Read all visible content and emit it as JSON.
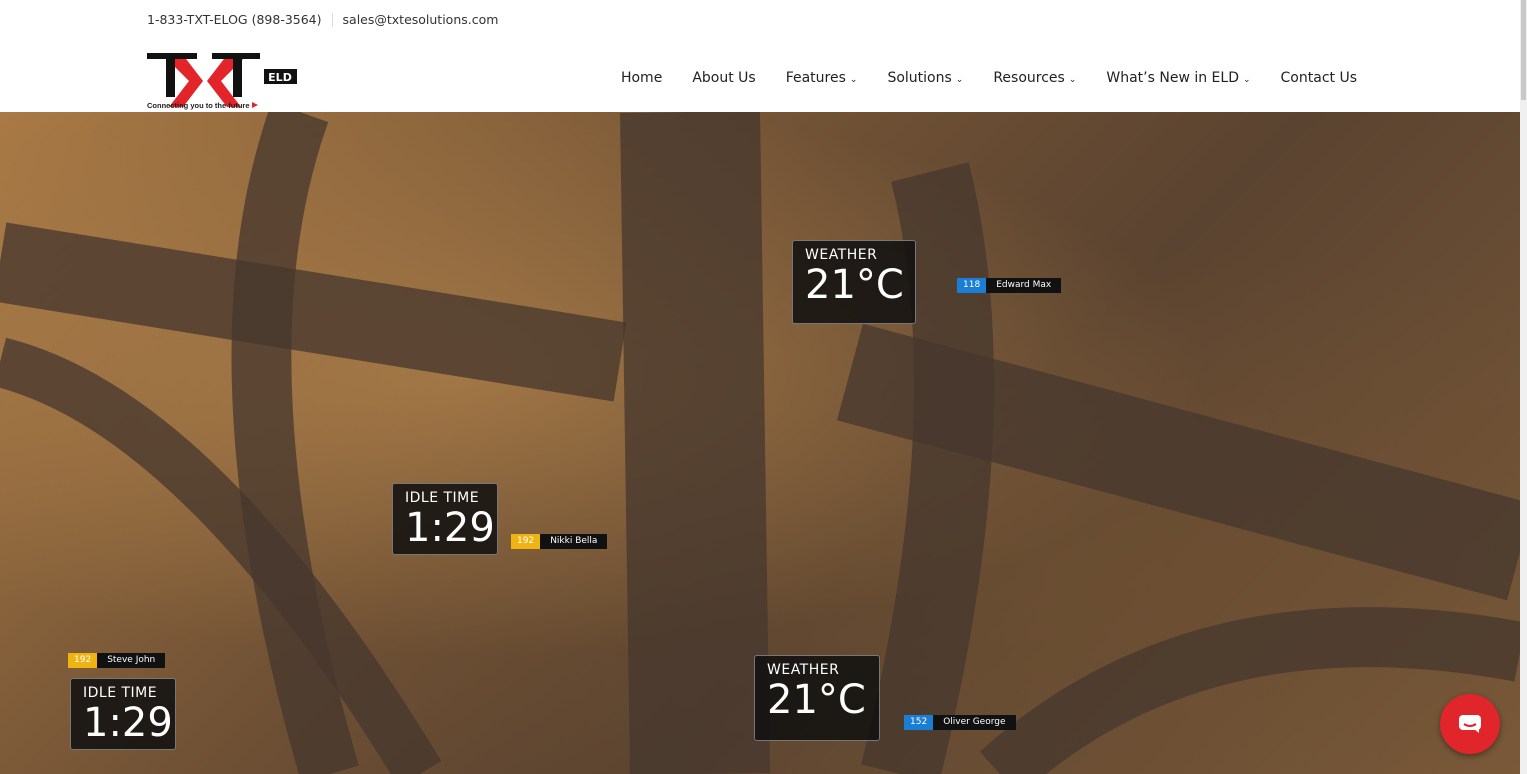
{
  "topbar": {
    "phone": "1-833-TXT-ELOG (898-3564)",
    "email": "sales@txtesolutions.com"
  },
  "logo": {
    "text": "TXT",
    "badge": "ELD",
    "tagline": "Connecting you to the future"
  },
  "nav": [
    {
      "label": "Home"
    },
    {
      "label": "About Us"
    },
    {
      "label": "Features",
      "dropdown": true
    },
    {
      "label": "Solutions",
      "dropdown": true
    },
    {
      "label": "Resources",
      "dropdown": true
    },
    {
      "label": "What’s New in ELD",
      "dropdown": true
    },
    {
      "label": "Contact Us"
    }
  ],
  "hero": {
    "cards": [
      {
        "title": "WEATHER",
        "value": "21°C"
      },
      {
        "title": "IDLE TIME",
        "value": "1:29"
      },
      {
        "title": "IDLE TIME",
        "value": "1:29"
      },
      {
        "title": "WEATHER",
        "value": "21°C"
      }
    ],
    "tags": [
      {
        "id": "118",
        "name": "Edward Max",
        "color": "#1a7fd4"
      },
      {
        "id": "192",
        "name": "Nikki Bella",
        "color": "#f0b412"
      },
      {
        "id": "192",
        "name": "Steve John",
        "color": "#f0b412"
      },
      {
        "id": "152",
        "name": "Oliver George",
        "color": "#1a7fd4"
      }
    ]
  },
  "chat": {
    "icon": "chat-icon",
    "color": "#e0262a"
  }
}
